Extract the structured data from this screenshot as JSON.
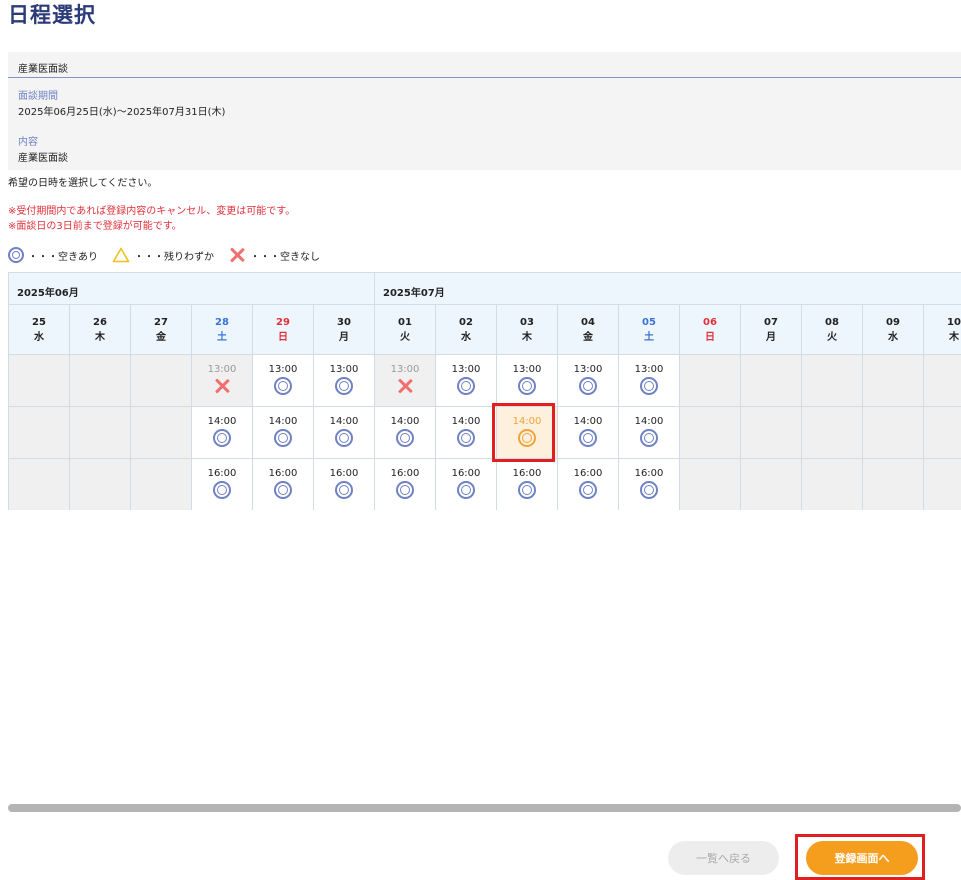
{
  "page": {
    "title": "日程選択"
  },
  "info": {
    "header": "産業医面談",
    "period_label": "面談期間",
    "period_value": "2025年06月25日(水)〜2025年07月31日(木)",
    "content_label": "内容",
    "content_value": "産業医面談"
  },
  "instruction": "希望の日時を選択してください。",
  "notes": [
    "※受付期間内であれば登録内容のキャンセル、変更は可能です。",
    "※面談日の3日前まで登録が可能です。"
  ],
  "legend": [
    {
      "icon": "double-circle-icon",
      "label": "・・・空きあり"
    },
    {
      "icon": "triangle-icon",
      "label": "・・・残りわずか"
    },
    {
      "icon": "cross-icon",
      "label": "・・・空きなし"
    }
  ],
  "calendar": {
    "months": [
      {
        "label": "2025年06月"
      },
      {
        "label": "2025年07月"
      }
    ],
    "days": [
      {
        "date": "25",
        "weekday": "水",
        "type": "weekday"
      },
      {
        "date": "26",
        "weekday": "木",
        "type": "weekday"
      },
      {
        "date": "27",
        "weekday": "金",
        "type": "weekday"
      },
      {
        "date": "28",
        "weekday": "土",
        "type": "sat"
      },
      {
        "date": "29",
        "weekday": "日",
        "type": "sun"
      },
      {
        "date": "30",
        "weekday": "月",
        "type": "weekday"
      },
      {
        "date": "01",
        "weekday": "火",
        "type": "weekday"
      },
      {
        "date": "02",
        "weekday": "水",
        "type": "weekday"
      },
      {
        "date": "03",
        "weekday": "木",
        "type": "weekday"
      },
      {
        "date": "04",
        "weekday": "金",
        "type": "weekday"
      },
      {
        "date": "05",
        "weekday": "土",
        "type": "sat"
      },
      {
        "date": "06",
        "weekday": "日",
        "type": "sun"
      },
      {
        "date": "07",
        "weekday": "月",
        "type": "weekday"
      },
      {
        "date": "08",
        "weekday": "火",
        "type": "weekday"
      },
      {
        "date": "09",
        "weekday": "水",
        "type": "weekday"
      },
      {
        "date": "10",
        "weekday": "木",
        "type": "weekday"
      }
    ],
    "slot_rows": [
      {
        "time": "13:00",
        "statuses": [
          "none",
          "none",
          "none",
          "full",
          "available",
          "available",
          "full",
          "available",
          "available",
          "available",
          "available",
          "none",
          "none",
          "none",
          "none",
          "none"
        ]
      },
      {
        "time": "14:00",
        "statuses": [
          "none",
          "none",
          "none",
          "available",
          "available",
          "available",
          "available",
          "available",
          "selected",
          "available",
          "available",
          "none",
          "none",
          "none",
          "none",
          "none"
        ]
      },
      {
        "time": "16:00",
        "statuses": [
          "none",
          "none",
          "none",
          "available",
          "available",
          "available",
          "available",
          "available",
          "available",
          "available",
          "available",
          "none",
          "none",
          "none",
          "none",
          "none"
        ]
      }
    ]
  },
  "buttons": {
    "back_label": "一覧へ戻る",
    "register_label": "登録画面へ"
  },
  "colors": {
    "title": "#2b3a78",
    "accent_orange": "#f59d1d",
    "available_blue": "#6f82c4",
    "full_red": "#f07070",
    "warning_red": "#e0303a",
    "saturday_blue": "#3a74d8"
  }
}
